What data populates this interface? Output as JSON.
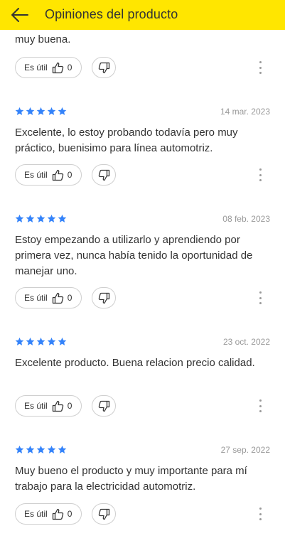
{
  "header": {
    "title": "Opiniones del producto",
    "background_color": "#ffe600"
  },
  "colors": {
    "star": "#3483fa",
    "text": "#333333",
    "date": "#999999"
  },
  "reviews": [
    {
      "date": "",
      "rating": 5,
      "text": "muy buena.",
      "useful_label": "Es útil",
      "useful_count": "0"
    },
    {
      "date": "14 mar. 2023",
      "rating": 5,
      "text": "Excelente, lo estoy probando todavía pero muy práctico, buenisimo para línea automotriz.",
      "useful_label": "Es útil",
      "useful_count": "0"
    },
    {
      "date": "08 feb. 2023",
      "rating": 5,
      "text": "Estoy empezando a utilizarlo y aprendiendo por primera vez, nunca había tenido la oportunidad de manejar uno.",
      "useful_label": "Es útil",
      "useful_count": "0"
    },
    {
      "date": "23 oct. 2022",
      "rating": 5,
      "text": "Excelente producto. Buena relacion precio calidad.",
      "useful_label": "Es útil",
      "useful_count": "0"
    },
    {
      "date": "27 sep. 2022",
      "rating": 5,
      "text": "Muy bueno el producto y muy importante para mí trabajo para la electricidad automotriz.",
      "useful_label": "Es útil",
      "useful_count": "0"
    }
  ]
}
